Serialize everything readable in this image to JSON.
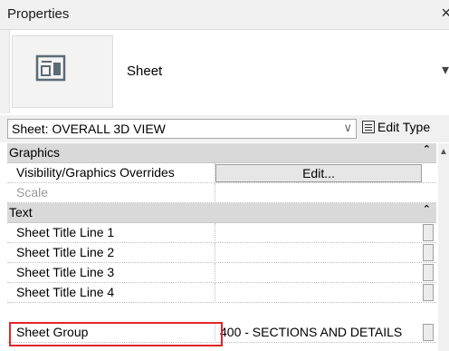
{
  "window": {
    "title": "Properties",
    "close_glyph": "×"
  },
  "type_selector": {
    "type_name": "Sheet",
    "icon": "sheet-icon"
  },
  "instance_selector": {
    "value": "Sheet: OVERALL 3D VIEW",
    "edit_type_label": "Edit Type"
  },
  "groups": [
    {
      "label": "Graphics",
      "rows": [
        {
          "name": "Visibility/Graphics Overrides",
          "value": "Edit...",
          "kind": "button"
        },
        {
          "name": "Scale",
          "value": "",
          "kind": "disabled"
        }
      ]
    },
    {
      "label": "Text",
      "rows": [
        {
          "name": "Sheet Title Line 1",
          "value": ""
        },
        {
          "name": "Sheet Title Line 2",
          "value": ""
        },
        {
          "name": "Sheet Title Line 3",
          "value": ""
        },
        {
          "name": "Sheet Title Line 4",
          "value": ""
        },
        {
          "name": "Sheet Group",
          "value": "400 - SECTIONS AND DETAILS"
        }
      ]
    }
  ],
  "highlight_color": "#e0262a"
}
